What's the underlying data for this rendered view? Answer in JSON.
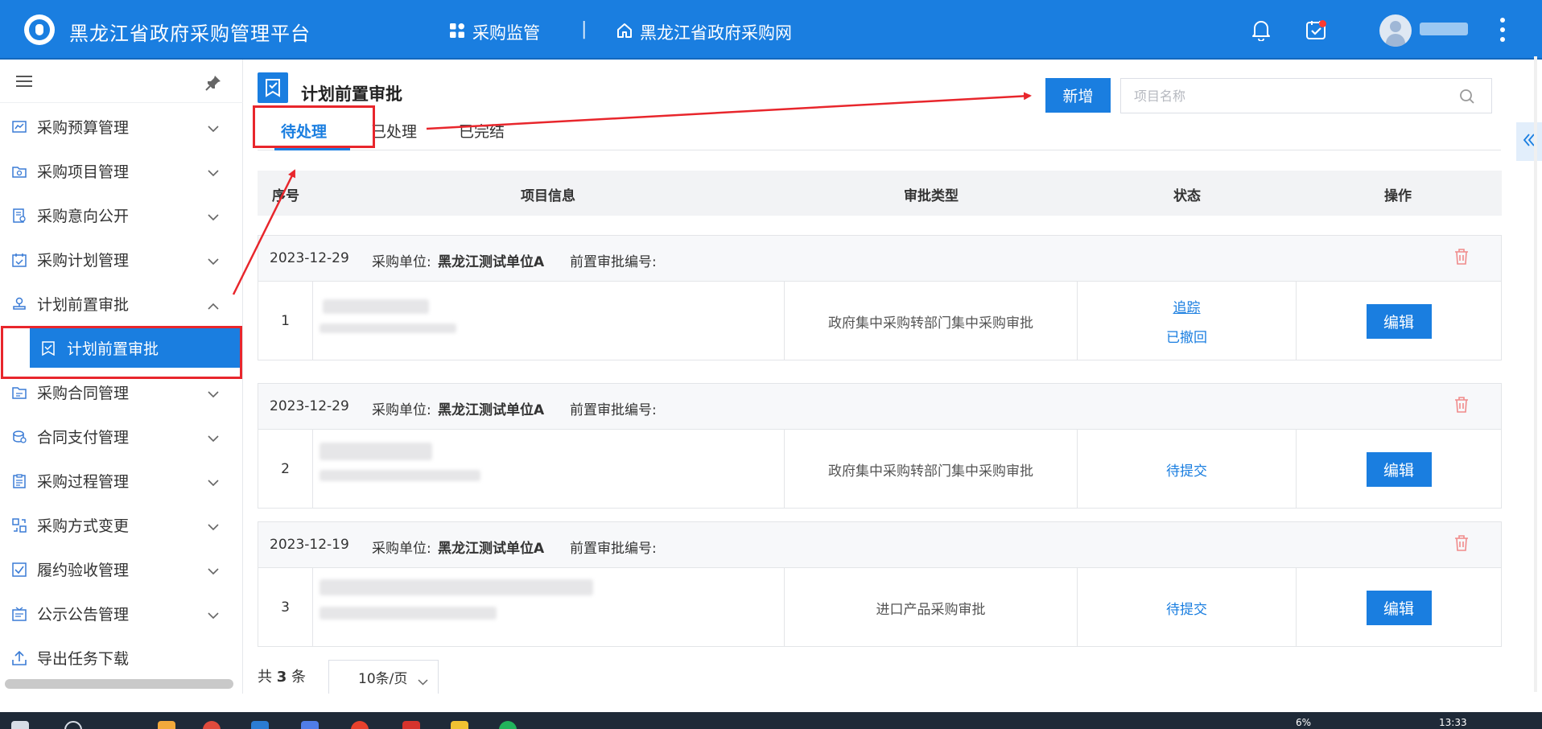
{
  "app": {
    "title": "黑龙江省政府采购管理平台",
    "nav": [
      {
        "label": "采购监管",
        "icon": "grid-icon"
      },
      {
        "label": "黑龙江省政府采购网",
        "icon": "home-icon"
      }
    ],
    "nav_separator": "|",
    "user_name": "用户",
    "has_notification_dot": true
  },
  "sidebar": {
    "items": [
      {
        "label": "采购预算管理",
        "icon": "chart-icon",
        "expanded": false
      },
      {
        "label": "采购项目管理",
        "icon": "folder-icon",
        "expanded": false
      },
      {
        "label": "采购意向公开",
        "icon": "document-icon",
        "expanded": false
      },
      {
        "label": "采购计划管理",
        "icon": "calendar-icon",
        "expanded": false
      },
      {
        "label": "计划前置审批",
        "icon": "stamp-icon",
        "expanded": true
      },
      {
        "label": "采购合同管理",
        "icon": "folder-icon",
        "expanded": false
      },
      {
        "label": "合同支付管理",
        "icon": "coins-icon",
        "expanded": false
      },
      {
        "label": "采购过程管理",
        "icon": "clipboard-icon",
        "expanded": false
      },
      {
        "label": "采购方式变更",
        "icon": "switch-icon",
        "expanded": false
      },
      {
        "label": "履约验收管理",
        "icon": "check-icon",
        "expanded": false
      },
      {
        "label": "公示公告管理",
        "icon": "notice-icon",
        "expanded": false
      },
      {
        "label": "导出任务下载",
        "icon": "upload-icon",
        "expanded": false
      }
    ],
    "active_subitem": "计划前置审批"
  },
  "page": {
    "title": "计划前置审批",
    "add_label": "新增",
    "search_placeholder": "项目名称",
    "tabs": [
      {
        "label": "待处理",
        "active": true
      },
      {
        "label": "已处理",
        "active": false
      },
      {
        "label": "已完结",
        "active": false
      }
    ]
  },
  "table": {
    "columns": [
      "序号",
      "项目信息",
      "审批类型",
      "状态",
      "操作"
    ],
    "unit_label": "采购单位:",
    "number_label": "前置审批编号:",
    "edit_label": "编辑",
    "groups": [
      {
        "date": "2023-12-29",
        "unit": "黑龙江测试单位A",
        "no": "1",
        "type": "政府集中采购转部门集中采购审批",
        "status_link": "追踪",
        "status": "已撤回"
      },
      {
        "date": "2023-12-29",
        "unit": "黑龙江测试单位A",
        "no": "2",
        "type": "政府集中采购转部门集中采购审批",
        "status_link": "",
        "status": "待提交"
      },
      {
        "date": "2023-12-19",
        "unit": "黑龙江测试单位A",
        "no": "3",
        "type": "进口产品采购审批",
        "status_link": "",
        "status": "待提交"
      }
    ]
  },
  "pager": {
    "prefix": "共",
    "total": "3",
    "suffix": "条",
    "page_size": "10条/页"
  },
  "taskbar": {
    "cpu": "6%",
    "time": "13:33"
  },
  "colors": {
    "primary": "#1a7ee0",
    "annotation_red": "#e8262c",
    "delete_red": "#f08a8a"
  }
}
